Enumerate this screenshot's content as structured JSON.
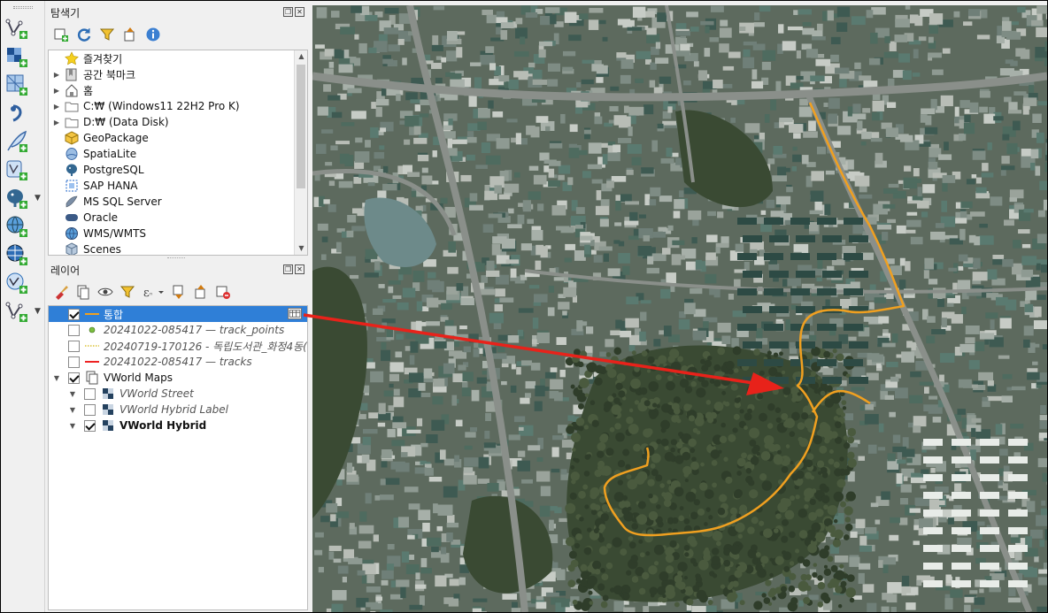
{
  "browser_panel": {
    "title": "탐색기",
    "items": [
      {
        "label": "즐겨찾기",
        "icon": "star-icon",
        "has_arrow": false
      },
      {
        "label": "공간 북마크",
        "icon": "bookmark-icon",
        "has_arrow": true
      },
      {
        "label": "홈",
        "icon": "home-icon",
        "has_arrow": true
      },
      {
        "label": "C:₩ (Windows11 22H2 Pro K)",
        "icon": "folder-icon",
        "has_arrow": true
      },
      {
        "label": "D:₩ (Data Disk)",
        "icon": "folder-icon",
        "has_arrow": true
      },
      {
        "label": "GeoPackage",
        "icon": "geopackage-icon",
        "has_arrow": false
      },
      {
        "label": "SpatiaLite",
        "icon": "spatialite-icon",
        "has_arrow": false
      },
      {
        "label": "PostgreSQL",
        "icon": "postgresql-icon",
        "has_arrow": false
      },
      {
        "label": "SAP HANA",
        "icon": "sap-hana-icon",
        "has_arrow": false
      },
      {
        "label": "MS SQL Server",
        "icon": "mssql-icon",
        "has_arrow": false
      },
      {
        "label": "Oracle",
        "icon": "oracle-icon",
        "has_arrow": false
      },
      {
        "label": "WMS/WMTS",
        "icon": "wms-icon",
        "has_arrow": false
      },
      {
        "label": "Scenes",
        "icon": "scenes-icon",
        "has_arrow": false
      }
    ]
  },
  "layers_panel": {
    "title": "레이어",
    "layers": [
      {
        "label": "통합",
        "checked": true,
        "style": "selected",
        "indent": 0,
        "symbol": "line-orange"
      },
      {
        "label": "20241022-085417 — track_points",
        "checked": false,
        "style": "italic",
        "indent": 0,
        "symbol": "point-green"
      },
      {
        "label": "20240719-170126 - 독립도서관_화정4동(",
        "checked": false,
        "style": "italic",
        "indent": 0,
        "symbol": "line-dotted-yellow"
      },
      {
        "label": "20241022-085417 — tracks",
        "checked": false,
        "style": "italic",
        "indent": 0,
        "symbol": "line-red"
      },
      {
        "label": "VWorld Maps",
        "checked": true,
        "style": "normal",
        "indent": 0,
        "symbol": "group-icon"
      },
      {
        "label": "VWorld Street",
        "checked": false,
        "style": "italic",
        "indent": 1,
        "symbol": "tile-icon"
      },
      {
        "label": "VWorld Hybrid Label",
        "checked": false,
        "style": "italic",
        "indent": 1,
        "symbol": "tile-icon"
      },
      {
        "label": "VWorld Hybrid",
        "checked": true,
        "style": "bold",
        "indent": 1,
        "symbol": "tile-icon"
      }
    ]
  },
  "colors": {
    "track": "#f0a020",
    "annotation_arrow": "#e8221a",
    "selection": "#2f7fd7"
  }
}
